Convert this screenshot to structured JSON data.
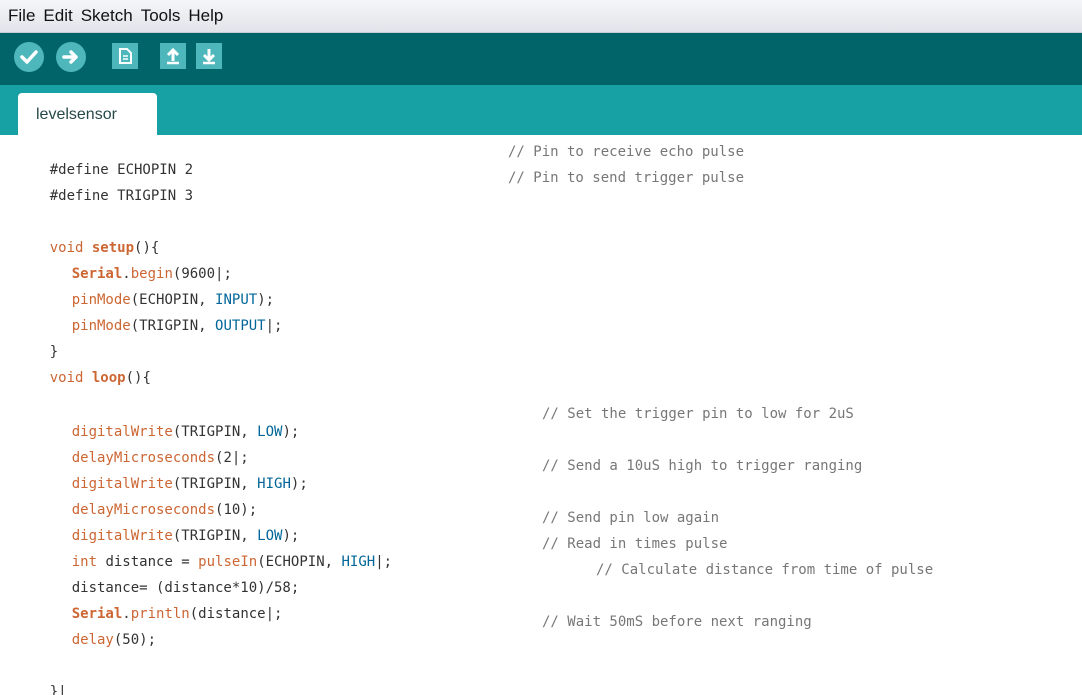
{
  "menu": [
    "File",
    "Edit",
    "Sketch",
    "Tools",
    "Help"
  ],
  "toolbar": {
    "buttons": [
      {
        "name": "verify-button",
        "icon": "checkmark-icon"
      },
      {
        "name": "upload-button",
        "icon": "arrow-right-icon"
      },
      {
        "name": "new-button",
        "icon": "new-document-icon"
      },
      {
        "name": "open-button",
        "icon": "arrow-up-icon"
      },
      {
        "name": "save-button",
        "icon": "arrow-down-icon"
      }
    ]
  },
  "tab": {
    "label": "levelsensor"
  },
  "code": {
    "define_echo": "#define ECHOPIN 2",
    "define_echo_comment": "// Pin to receive echo pulse",
    "define_trig": "#define TRIGPIN 3",
    "define_trig_comment": "// Pin to send trigger pulse",
    "setup_kw": "void",
    "setup_fn": "setup",
    "setup_rest": "(){",
    "serial_1": "Serial",
    "begin_1": "begin",
    "begin_args": "(9600|;",
    "pinmode_1": "pinMode",
    "pinmode_1_args_a": "(ECHOPIN, ",
    "pinmode_1_const": "INPUT",
    "pinmode_1_args_b": ");",
    "pinmode_2": "pinMode",
    "pinmode_2_args_a": "(TRIGPIN, ",
    "pinmode_2_const": "OUTPUT",
    "pinmode_2_args_b": "|;",
    "close_setup": "}",
    "loop_kw": "void",
    "loop_fn": "loop",
    "loop_rest": "(){",
    "dw_1": "digitalWrite",
    "dw_1_args_a": "(TRIGPIN, ",
    "dw_1_const": "LOW",
    "dw_1_args_b": ");",
    "dw_1_comment": "// Set the trigger pin to low for 2uS",
    "dm_1": "delayMicroseconds",
    "dm_1_args": "(2|;",
    "dw_2": "digitalWrite",
    "dw_2_args_a": "(TRIGPIN, ",
    "dw_2_const": "HIGH",
    "dw_2_args_b": ");",
    "dw_2_comment": "// Send a 10uS high to trigger ranging",
    "dm_2": "delayMicroseconds",
    "dm_2_args": "(10);",
    "dw_3": "digitalWrite",
    "dw_3_args_a": "(TRIGPIN, ",
    "dw_3_const": "LOW",
    "dw_3_args_b": ");",
    "dw_3_comment": "// Send pin low again",
    "int_kw": "int",
    "int_mid": " distance = ",
    "pulse_fn": "pulseIn",
    "pulse_args_a": "(ECHOPIN, ",
    "pulse_const": "HIGH",
    "pulse_args_b": "|;",
    "pulse_comment": "// Read in times pulse",
    "calc": "distance= (distance*10)/58;",
    "calc_comment": "// Calculate distance from time of pulse",
    "serial_2": "Serial",
    "println": "println",
    "println_args": "(distance|;",
    "delay_fn": "delay",
    "delay_args": "(50);",
    "delay_comment": "// Wait 50mS before next ranging",
    "close_loop": "}|"
  }
}
